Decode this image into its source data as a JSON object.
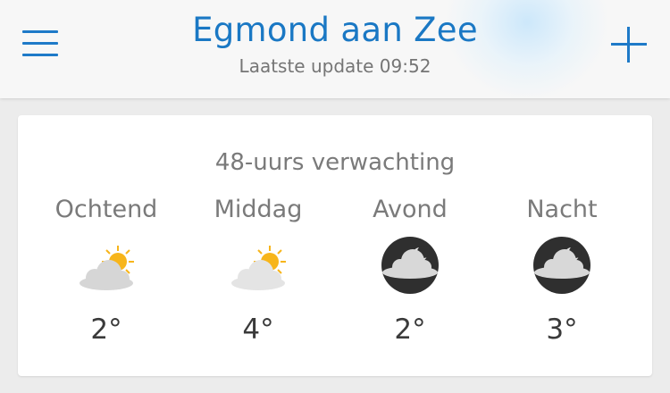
{
  "header": {
    "title": "Egmond aan Zee",
    "subtitle": "Laatste update 09:52"
  },
  "forecast": {
    "title": "48-uurs verwachting",
    "periods": [
      {
        "label": "Ochtend",
        "icon": "partly-cloudy-day-icon",
        "temp": "2°"
      },
      {
        "label": "Middag",
        "icon": "partly-cloudy-day-icon",
        "temp": "4°"
      },
      {
        "label": "Avond",
        "icon": "partly-cloudy-night-icon",
        "temp": "2°"
      },
      {
        "label": "Nacht",
        "icon": "partly-cloudy-night-icon",
        "temp": "3°"
      }
    ]
  },
  "colors": {
    "accent": "#1e7ac8",
    "sun": "#f7b51b",
    "cloud": "#d8d8d8",
    "night": "#2f2f2f"
  }
}
